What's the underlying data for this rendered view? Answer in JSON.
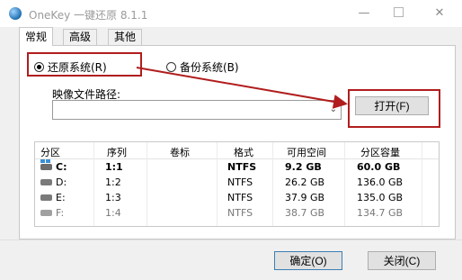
{
  "window": {
    "title": "OneKey 一键还原 8.1.1",
    "min_symbol": "—",
    "close_symbol": "✕"
  },
  "tabs": [
    {
      "label": "常规",
      "active": true
    },
    {
      "label": "高级",
      "active": false
    },
    {
      "label": "其他",
      "active": false
    }
  ],
  "restore": {
    "option_restore": "还原系统(R)",
    "option_backup": "备份系统(B)",
    "selected": "还原系统(R)"
  },
  "image": {
    "label": "映像文件路径:",
    "path_value": "",
    "open_button": "打开(F)"
  },
  "table": {
    "headers": [
      "分区",
      "序列",
      "卷标",
      "格式",
      "可用空间",
      "分区容量"
    ],
    "rows": [
      {
        "partition": "C:",
        "seq": "1:1",
        "label": "",
        "format": "NTFS",
        "free": "9.2 GB",
        "size": "60.0 GB"
      },
      {
        "partition": "D:",
        "seq": "1:2",
        "label": "",
        "format": "NTFS",
        "free": "26.2 GB",
        "size": "136.0 GB"
      },
      {
        "partition": "E:",
        "seq": "1:3",
        "label": "",
        "format": "NTFS",
        "free": "37.9 GB",
        "size": "135.0 GB"
      },
      {
        "partition": "F:",
        "seq": "1:4",
        "label": "",
        "format": "NTFS",
        "free": "38.7 GB",
        "size": "134.7 GB"
      }
    ]
  },
  "footer": {
    "ok_button": "确定(O)",
    "close_button": "关闭(C)"
  },
  "colors": {
    "annotation_red": "#b11d1d",
    "window_bg": "#f0f0f0",
    "button_bg": "#e1e1e1"
  },
  "icons": {
    "app": "onekey-app-icon",
    "disk": "disk-drive-icon",
    "system_disk": "windows-system-disk-icon",
    "dropdown": "chevron-down-icon"
  }
}
